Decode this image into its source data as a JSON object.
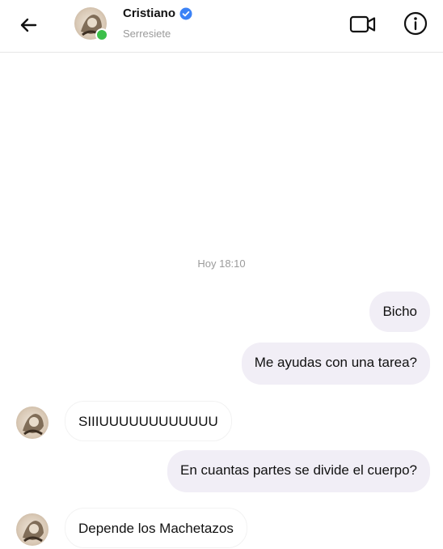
{
  "header": {
    "name": "Cristiano",
    "subtitle": "Serresiete",
    "icons": {
      "back": "arrow-left-icon",
      "verified": "verified-badge-icon",
      "video": "video-camera-icon",
      "info": "info-icon"
    },
    "colors": {
      "verified": "#3b82f6",
      "online": "#3cbf4a"
    }
  },
  "chat": {
    "timestamp": "Hoy 18:10",
    "messages": [
      {
        "from": "me",
        "text": "Bicho"
      },
      {
        "from": "me",
        "text": "Me ayudas con una tarea?"
      },
      {
        "from": "them",
        "text": "SIIIUUUUUUUUUUUU"
      },
      {
        "from": "me",
        "text": "En cuantas partes se divide el cuerpo?"
      },
      {
        "from": "them",
        "text": "Depende los Machetazos"
      }
    ]
  }
}
